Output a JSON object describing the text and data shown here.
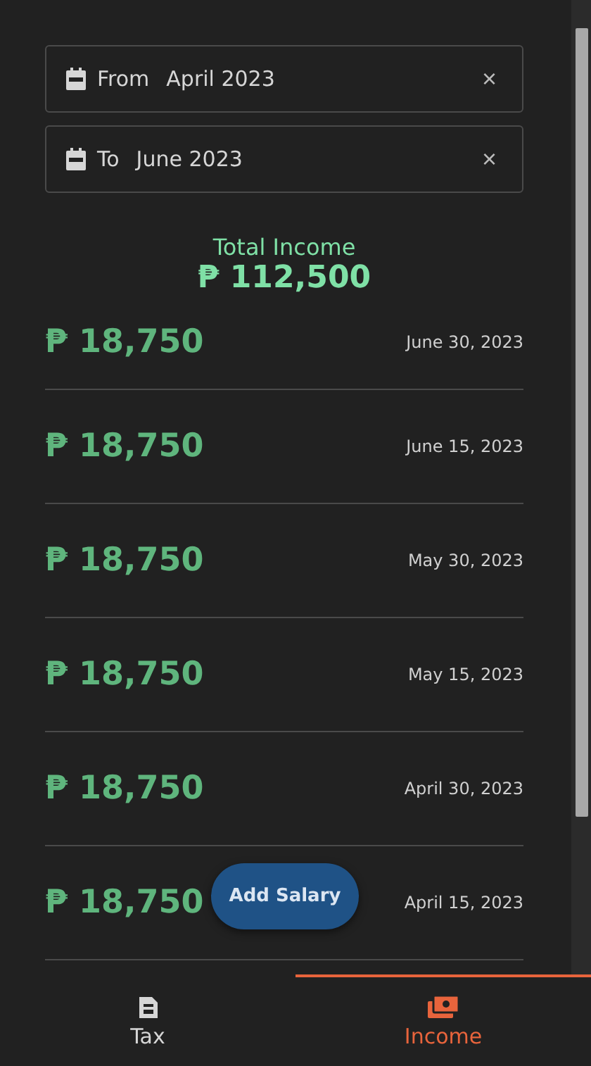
{
  "filters": [
    {
      "label": "From",
      "value": "April 2023",
      "clear": "×"
    },
    {
      "label": "To",
      "value": "June 2023",
      "clear": "×"
    }
  ],
  "total": {
    "label": "Total Income",
    "amount": "₱ 112,500"
  },
  "entries": [
    {
      "amount": "₱ 18,750",
      "date": "June 30, 2023"
    },
    {
      "amount": "₱ 18,750",
      "date": "June 15, 2023"
    },
    {
      "amount": "₱ 18,750",
      "date": "May 30, 2023"
    },
    {
      "amount": "₱ 18,750",
      "date": "May 15, 2023"
    },
    {
      "amount": "₱ 18,750",
      "date": "April 30, 2023"
    },
    {
      "amount": "₱ 18,750",
      "date": "April 15, 2023"
    }
  ],
  "add_button": "Add Salary",
  "nav": [
    {
      "label": "Tax",
      "kind": "document",
      "selected": false
    },
    {
      "label": "Income",
      "kind": "money",
      "selected": true
    }
  ]
}
